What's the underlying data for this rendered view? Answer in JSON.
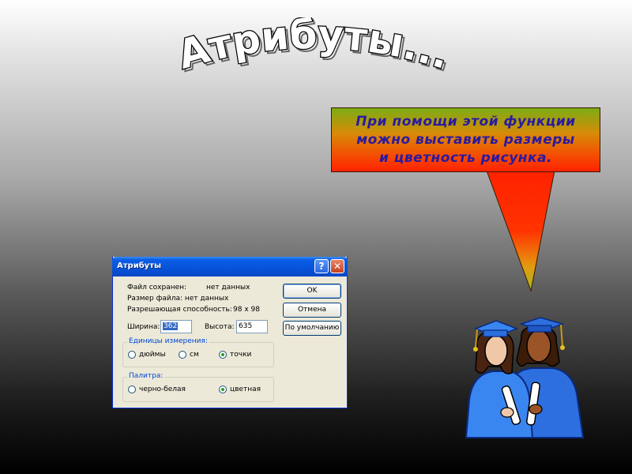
{
  "slide": {
    "title": "Атрибуты...",
    "callout_text": "При помощи этой функции\nможно выставить размеры\nи цветность рисунка."
  },
  "dialog": {
    "title": "Атрибуты",
    "help_glyph": "?",
    "close_glyph": "✕",
    "info": {
      "file_saved_label": "Файл сохранен:",
      "file_saved_value": "нет данных",
      "file_size_text": "Размер файла: нет данных",
      "resolution_label": "Разрешающая способность:",
      "resolution_value": "98 x 98"
    },
    "width_label": "Ширина:",
    "width_value": "362",
    "height_label": "Высота:",
    "height_value": "635",
    "buttons": {
      "ok": "OK",
      "cancel": "Отмена",
      "default": "По умолчанию"
    },
    "units": {
      "legend": "Единицы измерения:",
      "options": [
        "дюймы",
        "см",
        "точки"
      ],
      "selected": "точки"
    },
    "palette": {
      "legend": "Палитра:",
      "options": [
        "черно-белая",
        "цветная"
      ],
      "selected": "цветная"
    }
  },
  "colors": {
    "callout_text": "#2a1aa0",
    "callout_top": "#7cad14",
    "callout_bottom": "#ff2200",
    "titlebar": "#0753d9",
    "dialog_bg": "#ece9d8",
    "group_legend": "#0046d5"
  },
  "icons": {
    "help": "help-icon",
    "close": "close-icon",
    "clipart": "graduates-clipart"
  }
}
